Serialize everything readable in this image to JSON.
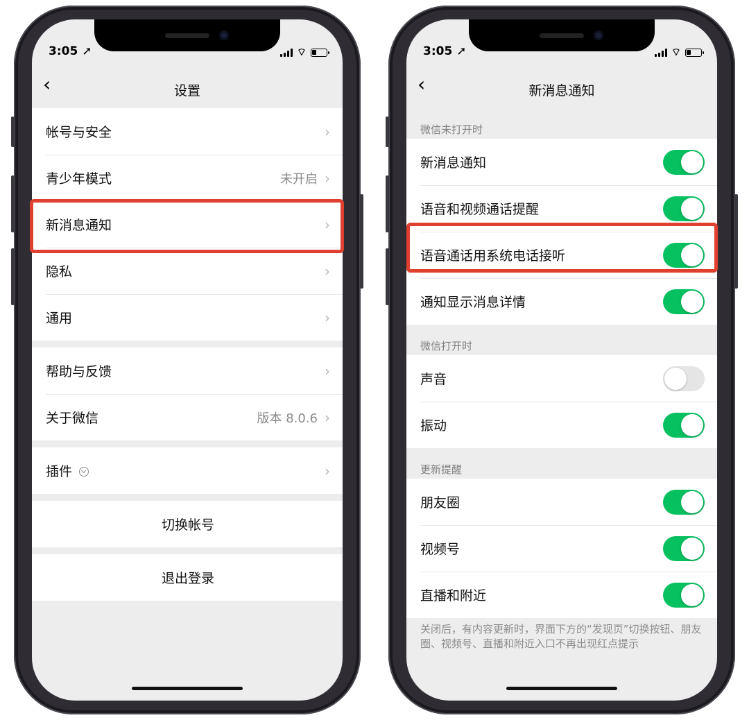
{
  "status": {
    "time": "3:05"
  },
  "left_screen": {
    "title": "设置",
    "items": [
      {
        "label": "帐号与安全",
        "value": ""
      },
      {
        "label": "青少年模式",
        "value": "未开启"
      },
      {
        "label": "新消息通知",
        "value": ""
      },
      {
        "label": "隐私",
        "value": ""
      },
      {
        "label": "通用",
        "value": ""
      },
      {
        "label": "帮助与反馈",
        "value": ""
      },
      {
        "label": "关于微信",
        "value": "版本 8.0.6"
      },
      {
        "label": "插件",
        "value": ""
      }
    ],
    "switch_account": "切换帐号",
    "logout": "退出登录"
  },
  "right_screen": {
    "title": "新消息通知",
    "section1": {
      "header": "微信未打开时",
      "items": [
        {
          "label": "新消息通知",
          "on": true
        },
        {
          "label": "语音和视频通话提醒",
          "on": true
        },
        {
          "label": "语音通话用系统电话接听",
          "on": true
        },
        {
          "label": "通知显示消息详情",
          "on": true
        }
      ]
    },
    "section2": {
      "header": "微信打开时",
      "items": [
        {
          "label": "声音",
          "on": false
        },
        {
          "label": "振动",
          "on": true
        }
      ]
    },
    "section3": {
      "header": "更新提醒",
      "items": [
        {
          "label": "朋友圈",
          "on": true
        },
        {
          "label": "视频号",
          "on": true
        },
        {
          "label": "直播和附近",
          "on": true
        }
      ]
    },
    "footnote": "关闭后，有内容更新时，界面下方的“发现页”切换按钮、朋友圈、视频号、直播和附近入口不再出现红点提示"
  },
  "colors": {
    "toggle_on": "#07c160",
    "highlight": "#e0402f"
  }
}
